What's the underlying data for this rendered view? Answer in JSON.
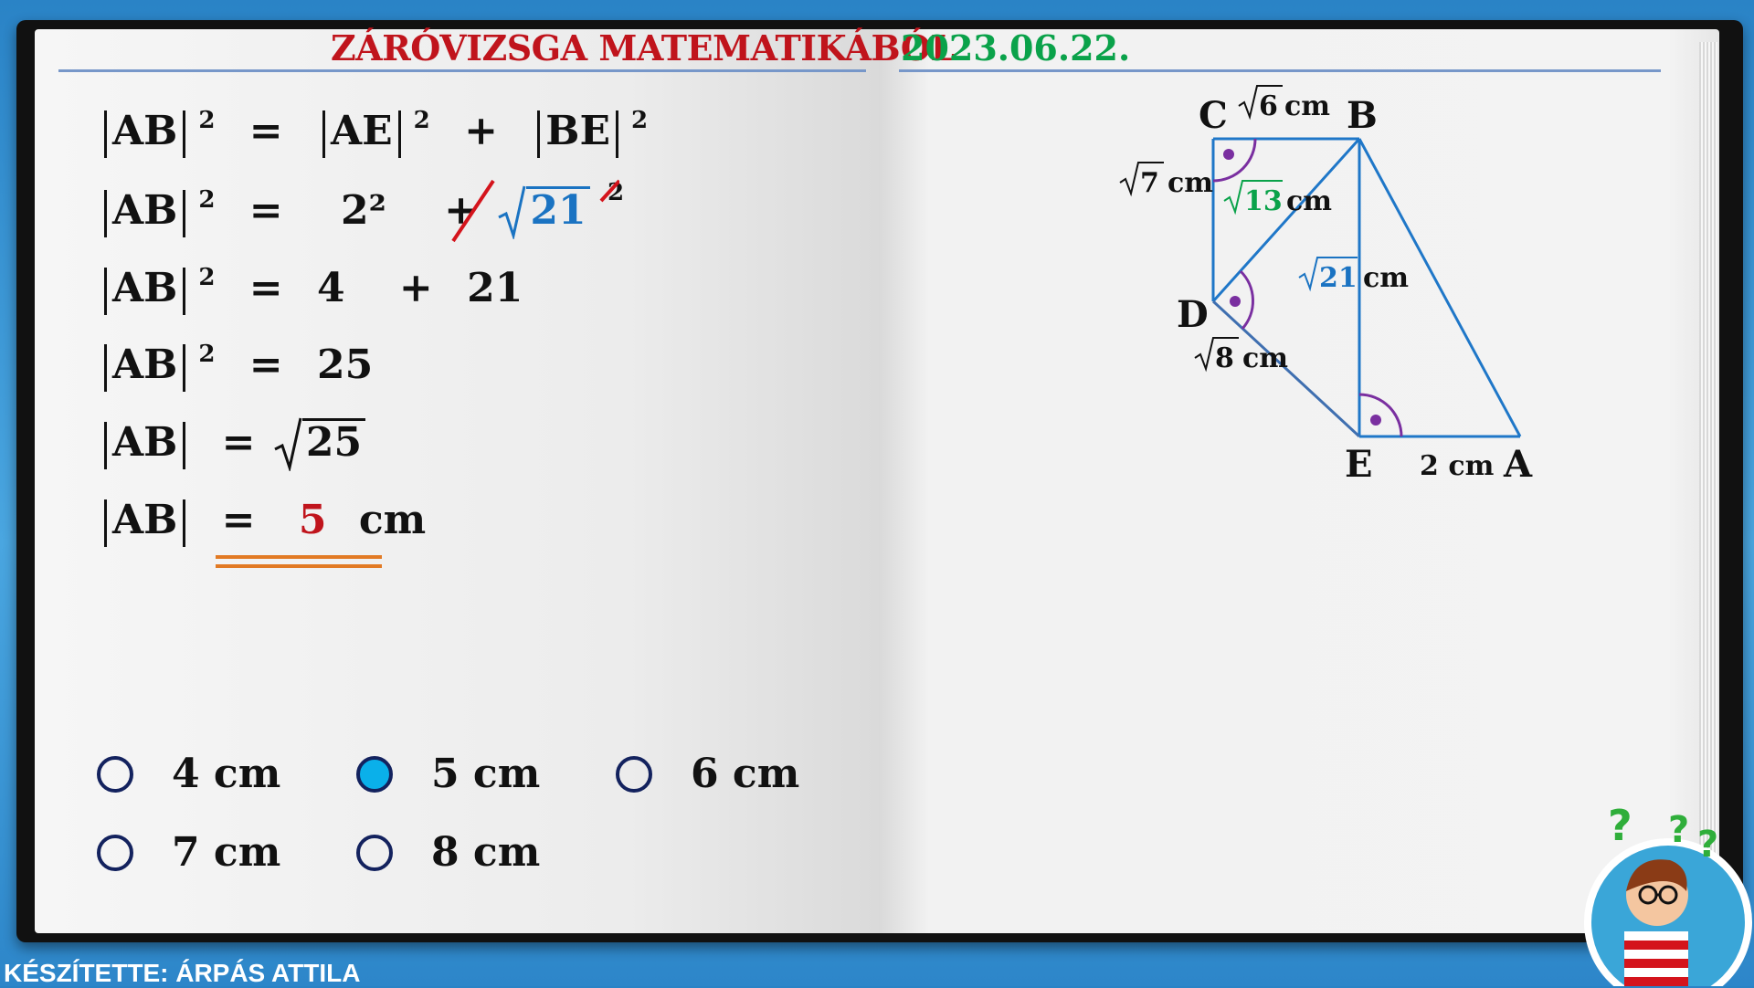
{
  "header": {
    "title": "ZÁRÓVIZSGA MATEMATIKÁBÓL",
    "date": "2023.06.22."
  },
  "derivation": {
    "line1": {
      "lhs": "AB",
      "exp": "2",
      "eq": "=",
      "term1": "AE",
      "plus": "+",
      "term2": "BE"
    },
    "line2": {
      "lhs": "AB",
      "exp": "2",
      "eq": "=",
      "term1": "2²",
      "plus": "+",
      "root": "21",
      "exp2": "2"
    },
    "line3": {
      "lhs": "AB",
      "exp": "2",
      "eq": "=",
      "term1": "4",
      "plus": "+",
      "term2": "21"
    },
    "line4": {
      "lhs": "AB",
      "exp": "2",
      "eq": "=",
      "result": "25"
    },
    "line5": {
      "lhs": "AB",
      "eq": "=",
      "root": "25"
    },
    "line6": {
      "lhs": "AB",
      "eq": "=",
      "value": "5",
      "unit": "cm"
    }
  },
  "options": [
    {
      "label": "4 cm",
      "selected": false
    },
    {
      "label": "5 cm",
      "selected": true
    },
    {
      "label": "6 cm",
      "selected": false
    },
    {
      "label": "7 cm",
      "selected": false
    },
    {
      "label": "8 cm",
      "selected": false
    }
  ],
  "figure": {
    "vertices": {
      "C": "C",
      "B": "B",
      "D": "D",
      "E": "E",
      "A": "A"
    },
    "labels": {
      "cb_root": "6",
      "cd_root": "7",
      "db_root": "13",
      "be_root": "21",
      "de_root": "8",
      "ea": "2 cm",
      "unit": "cm"
    }
  },
  "footer": {
    "author": "KÉSZÍTETTE: ÁRPÁS ATTILA"
  },
  "colors": {
    "title": "#c0141c",
    "date": "#0aa24a",
    "accent_blue": "#1a73c2",
    "angle_mark": "#7a2fa0",
    "answer": "#c0141c",
    "underline": "#e27a24"
  }
}
